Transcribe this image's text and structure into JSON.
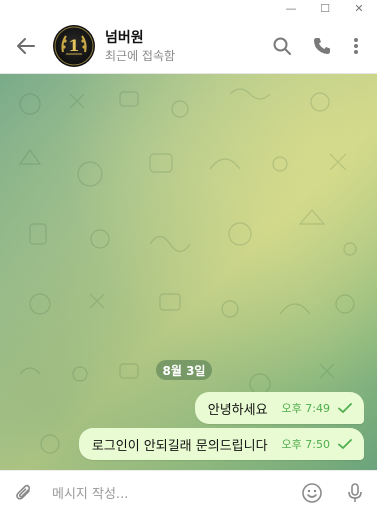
{
  "window": {
    "minimize_symbol": "—",
    "maximize_symbol": "☐",
    "close_symbol": "✕"
  },
  "header": {
    "contact_name": "넘버원",
    "status": "최근에 접속함",
    "avatar_badge": "1",
    "icons": [
      "back-arrow-icon",
      "search-icon",
      "phone-icon",
      "more-vertical-icon"
    ]
  },
  "chat": {
    "date_separator": "8월 3일",
    "messages": [
      {
        "text": "안녕하세요",
        "time": "오후 7:49",
        "status": "read"
      },
      {
        "text": "로그인이 안되길래 문의드립니다",
        "time": "오후 7:50",
        "status": "read"
      }
    ],
    "colors": {
      "outgoing_bubble": "#e9fbd3",
      "time_and_check": "#4fae4e"
    }
  },
  "composer": {
    "placeholder": "메시지 작성...",
    "icons": [
      "attach-icon",
      "emoji-icon",
      "microphone-icon"
    ]
  }
}
